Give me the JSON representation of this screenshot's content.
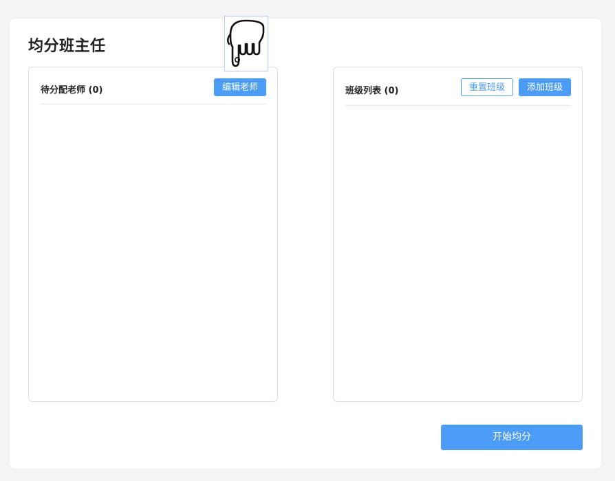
{
  "page": {
    "title": "均分班主任"
  },
  "teachers_panel": {
    "title": "待分配老师 (0)",
    "edit_button": "编辑老师"
  },
  "classes_panel": {
    "title": "班级列表 (0)",
    "reset_button": "重置班级",
    "add_button": "添加班级"
  },
  "actions": {
    "start_button": "开始均分"
  },
  "colors": {
    "accent": "#4a9cf7",
    "background": "#f4f4f4",
    "card": "#ffffff",
    "border": "#dcdcdc"
  },
  "icons": {
    "cursor": "hand-pointer-icon"
  }
}
